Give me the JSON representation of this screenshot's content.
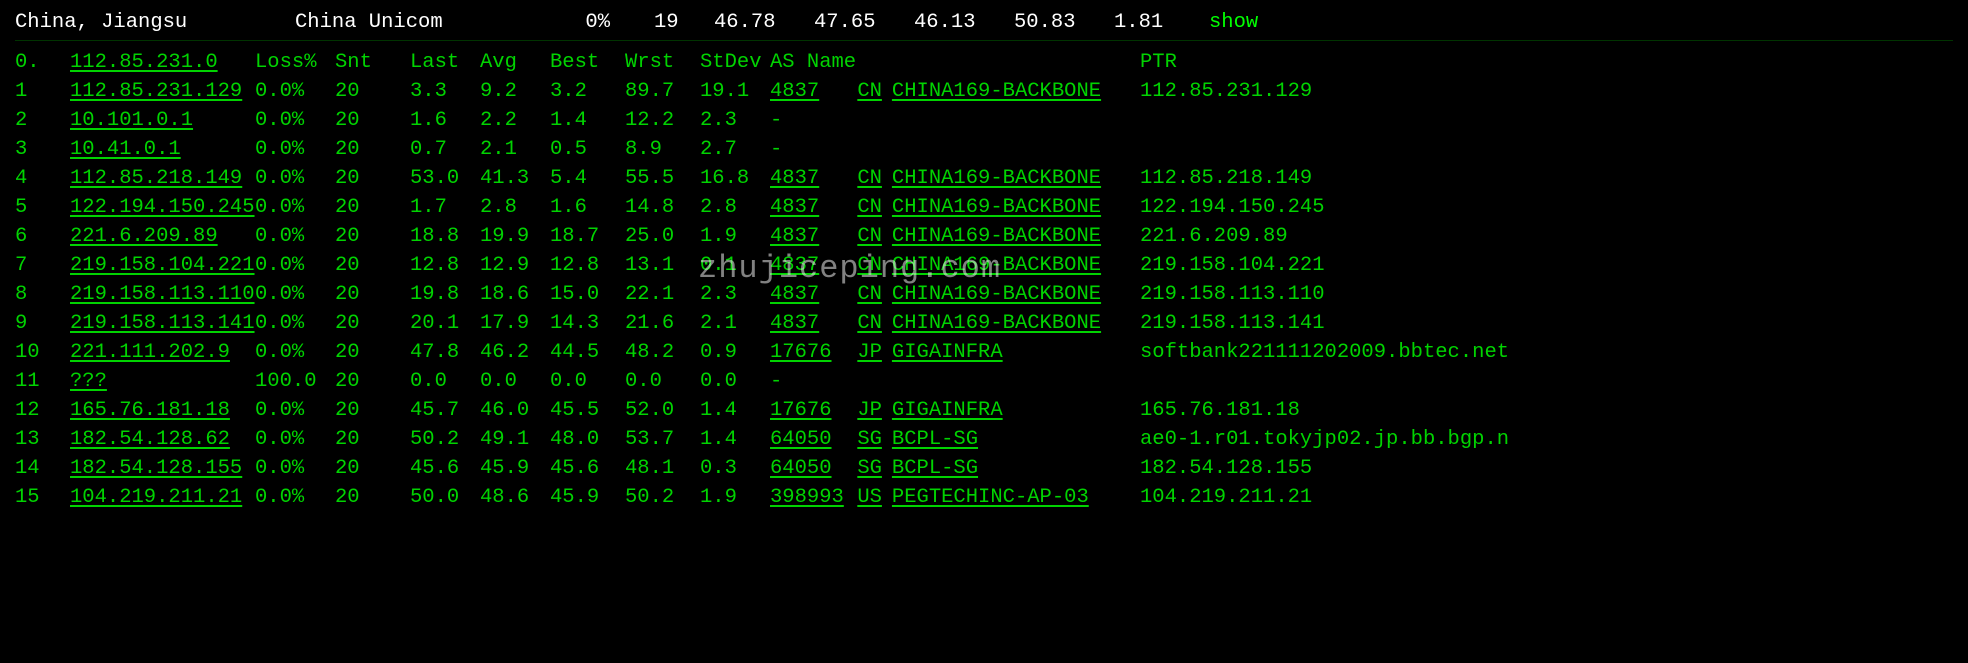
{
  "summary": {
    "location": "China, Jiangsu",
    "isp": "China Unicom",
    "loss": "0%",
    "count": "19",
    "v1": "46.78",
    "v2": "47.65",
    "v3": "46.13",
    "v4": "50.83",
    "v5": "1.81",
    "action": "show"
  },
  "headers": {
    "idx": "0.",
    "ip": "112.85.231.0",
    "loss": "Loss%",
    "snt": "Snt",
    "last": "Last",
    "avg": "Avg",
    "best": "Best",
    "wrst": "Wrst",
    "stdev": "StDev",
    "as": "AS Name",
    "ptr": "PTR"
  },
  "hops": [
    {
      "idx": "1",
      "ip": "112.85.231.129",
      "loss": "0.0%",
      "snt": "20",
      "last": "3.3",
      "avg": "9.2",
      "best": "3.2",
      "wrst": "89.7",
      "stdev": "19.1",
      "asn": "4837",
      "cc": "CN",
      "asname": "CHINA169-BACKBONE",
      "ptr": "112.85.231.129",
      "has_as": true
    },
    {
      "idx": "2",
      "ip": "10.101.0.1",
      "loss": "0.0%",
      "snt": "20",
      "last": "1.6",
      "avg": "2.2",
      "best": "1.4",
      "wrst": "12.2",
      "stdev": "2.3",
      "asn": "",
      "cc": "",
      "asname": "",
      "dash": "-",
      "ptr": "",
      "has_as": false
    },
    {
      "idx": "3",
      "ip": "10.41.0.1",
      "loss": "0.0%",
      "snt": "20",
      "last": "0.7",
      "avg": "2.1",
      "best": "0.5",
      "wrst": "8.9",
      "stdev": "2.7",
      "asn": "",
      "cc": "",
      "asname": "",
      "dash": "-",
      "ptr": "",
      "has_as": false
    },
    {
      "idx": "4",
      "ip": "112.85.218.149",
      "loss": "0.0%",
      "snt": "20",
      "last": "53.0",
      "avg": "41.3",
      "best": "5.4",
      "wrst": "55.5",
      "stdev": "16.8",
      "asn": "4837",
      "cc": "CN",
      "asname": "CHINA169-BACKBONE",
      "ptr": "112.85.218.149",
      "has_as": true
    },
    {
      "idx": "5",
      "ip": "122.194.150.245",
      "loss": "0.0%",
      "snt": "20",
      "last": "1.7",
      "avg": "2.8",
      "best": "1.6",
      "wrst": "14.8",
      "stdev": "2.8",
      "asn": "4837",
      "cc": "CN",
      "asname": "CHINA169-BACKBONE",
      "ptr": "122.194.150.245",
      "has_as": true
    },
    {
      "idx": "6",
      "ip": "221.6.209.89",
      "loss": "0.0%",
      "snt": "20",
      "last": "18.8",
      "avg": "19.9",
      "best": "18.7",
      "wrst": "25.0",
      "stdev": "1.9",
      "asn": "4837",
      "cc": "CN",
      "asname": "CHINA169-BACKBONE",
      "ptr": "221.6.209.89",
      "has_as": true
    },
    {
      "idx": "7",
      "ip": "219.158.104.221",
      "loss": "0.0%",
      "snt": "20",
      "last": "12.8",
      "avg": "12.9",
      "best": "12.8",
      "wrst": "13.1",
      "stdev": "0.1",
      "asn": "4837",
      "cc": "CN",
      "asname": "CHINA169-BACKBONE",
      "ptr": "219.158.104.221",
      "has_as": true
    },
    {
      "idx": "8",
      "ip": "219.158.113.110",
      "loss": "0.0%",
      "snt": "20",
      "last": "19.8",
      "avg": "18.6",
      "best": "15.0",
      "wrst": "22.1",
      "stdev": "2.3",
      "asn": "4837",
      "cc": "CN",
      "asname": "CHINA169-BACKBONE",
      "ptr": "219.158.113.110",
      "has_as": true
    },
    {
      "idx": "9",
      "ip": "219.158.113.141",
      "loss": "0.0%",
      "snt": "20",
      "last": "20.1",
      "avg": "17.9",
      "best": "14.3",
      "wrst": "21.6",
      "stdev": "2.1",
      "asn": "4837",
      "cc": "CN",
      "asname": "CHINA169-BACKBONE",
      "ptr": "219.158.113.141",
      "has_as": true
    },
    {
      "idx": "10",
      "ip": "221.111.202.9",
      "loss": "0.0%",
      "snt": "20",
      "last": "47.8",
      "avg": "46.2",
      "best": "44.5",
      "wrst": "48.2",
      "stdev": "0.9",
      "asn": "17676",
      "cc": "JP",
      "asname": "GIGAINFRA",
      "ptr": "softbank221111202009.bbtec.net",
      "has_as": true
    },
    {
      "idx": "11",
      "ip": "???",
      "loss": "100.0",
      "snt": "20",
      "last": "0.0",
      "avg": "0.0",
      "best": "0.0",
      "wrst": "0.0",
      "stdev": "0.0",
      "asn": "",
      "cc": "",
      "asname": "",
      "dash": "-",
      "ptr": "",
      "has_as": false
    },
    {
      "idx": "12",
      "ip": "165.76.181.18",
      "loss": "0.0%",
      "snt": "20",
      "last": "45.7",
      "avg": "46.0",
      "best": "45.5",
      "wrst": "52.0",
      "stdev": "1.4",
      "asn": "17676",
      "cc": "JP",
      "asname": "GIGAINFRA",
      "ptr": "165.76.181.18",
      "has_as": true
    },
    {
      "idx": "13",
      "ip": "182.54.128.62",
      "loss": "0.0%",
      "snt": "20",
      "last": "50.2",
      "avg": "49.1",
      "best": "48.0",
      "wrst": "53.7",
      "stdev": "1.4",
      "asn": "64050",
      "cc": "SG",
      "asname": "BCPL-SG",
      "ptr": "ae0-1.r01.tokyjp02.jp.bb.bgp.n",
      "has_as": true
    },
    {
      "idx": "14",
      "ip": "182.54.128.155",
      "loss": "0.0%",
      "snt": "20",
      "last": "45.6",
      "avg": "45.9",
      "best": "45.6",
      "wrst": "48.1",
      "stdev": "0.3",
      "asn": "64050",
      "cc": "SG",
      "asname": "BCPL-SG",
      "ptr": "182.54.128.155",
      "has_as": true
    },
    {
      "idx": "15",
      "ip": "104.219.211.21",
      "loss": "0.0%",
      "snt": "20",
      "last": "50.0",
      "avg": "48.6",
      "best": "45.9",
      "wrst": "50.2",
      "stdev": "1.9",
      "asn": "398993",
      "cc": "US",
      "asname": "PEGTECHINC-AP-03",
      "ptr": "104.219.211.21",
      "has_as": true
    }
  ],
  "watermark": "zhujiceping.com"
}
